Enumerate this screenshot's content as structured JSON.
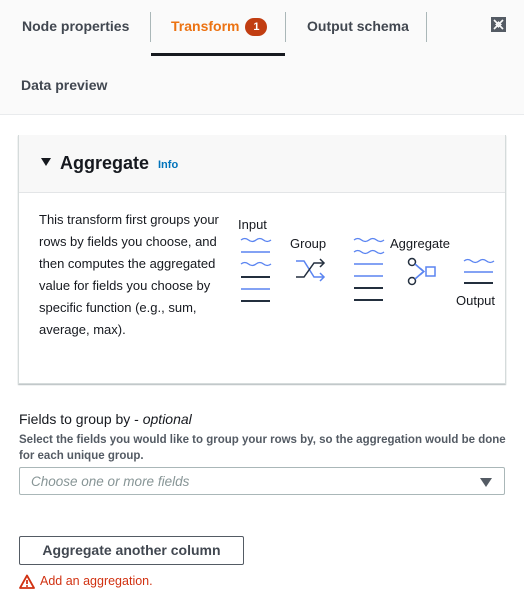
{
  "tabs": {
    "node_properties": "Node properties",
    "transform": "Transform",
    "transform_badge": "1",
    "output_schema": "Output schema",
    "data_preview": "Data preview",
    "active": "Transform"
  },
  "icons": {
    "expand": "expand-icon"
  },
  "colors": {
    "active_tab": "#ec7211",
    "badge": "#c13d11",
    "link": "#0073bb",
    "error": "#d13212",
    "diagram_blue": "#5a84f1",
    "diagram_dark": "#232f3e"
  },
  "panel": {
    "title": "Aggregate",
    "info_link": "Info",
    "description": "This transform first groups your rows by fields you choose, and then computes the aggregated value for fields you choose by specific function (e.g., sum, average, max).",
    "diagram": {
      "input_label": "Input",
      "group_label": "Group",
      "aggregate_label": "Aggregate",
      "output_label": "Output"
    }
  },
  "group_by": {
    "label": "Fields to group by - ",
    "label_optional": "optional",
    "description": "Select the fields you would like to group your rows by, so the aggregation would be done for each unique group.",
    "placeholder": "Choose one or more fields"
  },
  "actions": {
    "aggregate_another_column": "Aggregate another column"
  },
  "validation": {
    "error": "Add an aggregation."
  }
}
